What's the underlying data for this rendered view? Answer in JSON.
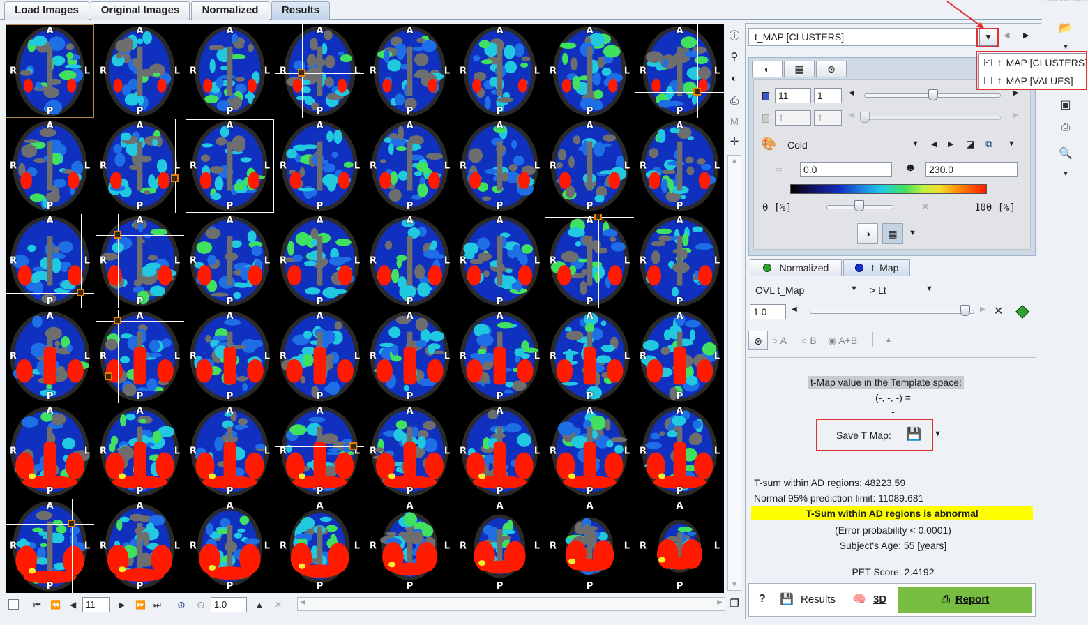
{
  "tabs": [
    {
      "label": "Load Images",
      "active": false
    },
    {
      "label": "Original Images",
      "active": false
    },
    {
      "label": "Normalized",
      "active": false
    },
    {
      "label": "Results",
      "active": true
    }
  ],
  "grid": {
    "orientation": {
      "anterior": "A",
      "posterior": "P",
      "right": "R",
      "left": "L"
    },
    "rows": 6,
    "cols": 8,
    "colors": {
      "background": "#000000",
      "brain_gray": "#6e6e6e",
      "dark_blue": "#1030c0",
      "blue": "#1e6ee6",
      "cyan": "#20c8e0",
      "green": "#40e060",
      "yellow": "#f0f030",
      "red": "#ff1a00",
      "marker": "#e87d00"
    }
  },
  "bottom_nav": {
    "slice_value": "11",
    "zoom_value": "1.0",
    "icons": [
      "checkbox-icon",
      "first-icon",
      "fast-back-icon",
      "back-icon",
      "forward-icon",
      "fast-forward-icon",
      "last-icon",
      "zoom-in-icon",
      "zoom-out-icon",
      "triangle-up-icon",
      "close-icon"
    ]
  },
  "right_panel": {
    "series_combo": "t_MAP [CLUSTERS]",
    "series_menu": {
      "items": [
        {
          "label": "t_MAP [CLUSTERS]",
          "checked": true
        },
        {
          "label": "t_MAP [VALUES]",
          "checked": false
        }
      ]
    },
    "color_panel": {
      "frame_value": "11",
      "frame_value2": "1",
      "disabled_value": "1",
      "disabled_value2": "1",
      "colormap": "Cold",
      "min_value": "0.0",
      "max_value": "230.0",
      "pct_min": "0 [%]",
      "pct_max": "100 [%]"
    },
    "layer_tabs": [
      {
        "label": "Normalized",
        "color": "#30a030"
      },
      {
        "label": "t_Map",
        "color": "#1030d0"
      }
    ],
    "overlay": {
      "mode": "OVL t_Map",
      "threshold_mode": "> Lt",
      "value": "1.0",
      "radio_a": "A",
      "radio_b": "B",
      "radio_ab": "A+B"
    },
    "template_info": {
      "title": "t-Map value in the Template space:",
      "coords": "(-, -, -) =",
      "dash": "-"
    },
    "save_tmap_label": "Save T Map:",
    "results": {
      "tsum": "T-sum within AD regions: 48223.59",
      "limit": "Normal 95% prediction limit: 11089.681",
      "abnormal": "T-Sum within AD regions is abnormal",
      "error_prob": "(Error probability < 0.0001)",
      "age": "Subject's Age: 55 [years]",
      "pet_score": "PET Score: 2.4192"
    },
    "buttons": {
      "help": "?",
      "results": "Results",
      "three_d": "3D",
      "report": "Report"
    }
  }
}
